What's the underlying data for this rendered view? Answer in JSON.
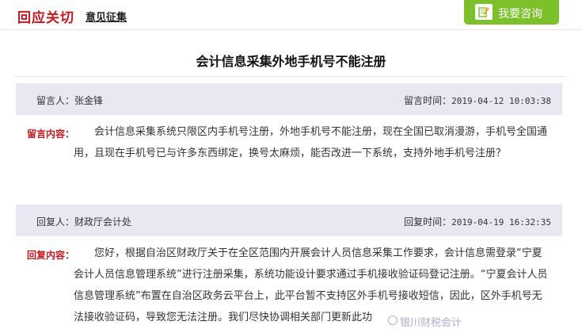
{
  "header": {
    "brand": "回应关切",
    "section": "意见征集",
    "consult_button": "我要咨询"
  },
  "title": "会计信息采集外地手机号不能注册",
  "message": {
    "author_label": "留言人：",
    "author": "张金锋",
    "time_label": "留言时间：",
    "time": "2019-04-12 10:03:38",
    "content_label": "留言内容：",
    "content": "会计信息采集系统只限区内手机号注册，外地手机号不能注册，现在全国已取消漫游，手机号全国通用，且现在手机号已与许多东西绑定，换号太麻烦，能否改进一下系统，支持外地手机号注册？"
  },
  "reply": {
    "author_label": "回复人：",
    "author": "财政厅会计处",
    "time_label": "回复时间：",
    "time": "2019-04-19 16:32:35",
    "content_label": "回复内容：",
    "content": "您好，根据自治区财政厅关于在全区范围内开展会计人员信息采集工作要求，会计信息需登录“宁夏会计人员信息管理系统”进行注册采集，系统功能设计要求通过手机接收验证码登记注册。“宁夏会计人员信息管理系统”布置在自治区政务云平台上，此平台暂不支持区外手机号接收短信，因此，区外手机号无法接收验证码，导致您无法注册。我们尽快协调相关部门更新此功"
  },
  "watermark": "银川财税会计"
}
